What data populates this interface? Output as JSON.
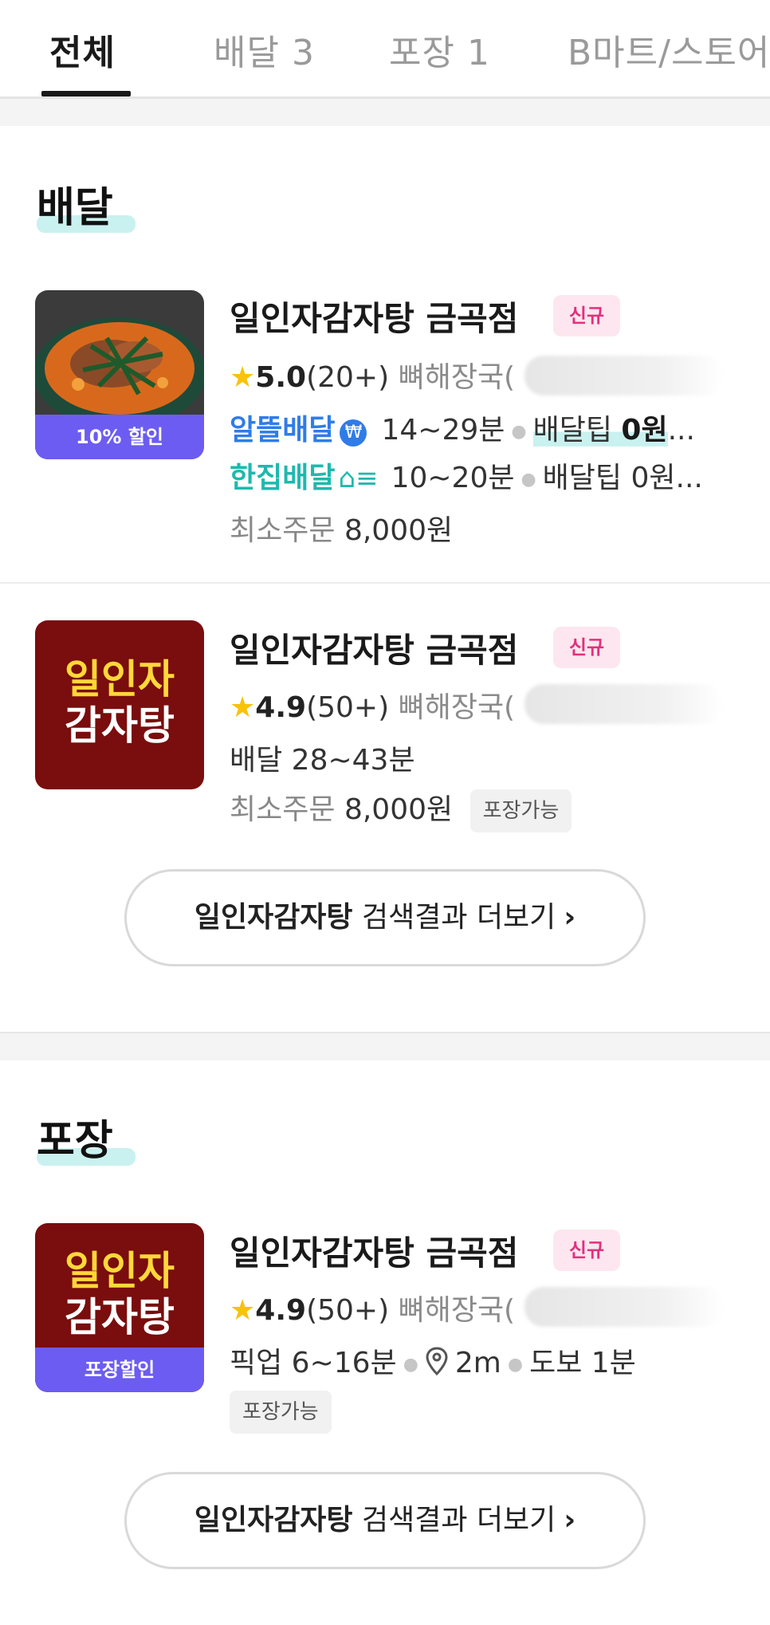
{
  "tabs": [
    {
      "label": "전체",
      "active": true
    },
    {
      "label": "배달 3",
      "active": false
    },
    {
      "label": "포장 1",
      "active": false
    },
    {
      "label": "B마트/스토어",
      "active": false
    }
  ],
  "sections": {
    "delivery": {
      "title": "배달",
      "stores": [
        {
          "name": "일인자감자탕 금곡점",
          "new_badge": "신규",
          "rating": "5.0",
          "review_count": "(20+)",
          "menu": "뼈해장국(",
          "thumb_badge": "10% 할인",
          "options": [
            {
              "brand": "알뜰배달",
              "time": "14~29분",
              "tip_label": "배달팁",
              "tip_value": "0원",
              "tip_suffix": "..."
            },
            {
              "brand": "한집배달",
              "time": "10~20분",
              "tip_label": "배달팁",
              "tip_value": "0원",
              "tip_suffix": "..."
            }
          ],
          "min_order_label": "최소주문",
          "min_order_value": "8,000원"
        },
        {
          "name": "일인자감자탕 금곡점",
          "new_badge": "신규",
          "rating": "4.9",
          "review_count": "(50+)",
          "menu": "뼈해장국(",
          "logo_line1": "일인자",
          "logo_line2": "감자탕",
          "delivery_time": "배달 28~43분",
          "min_order_label": "최소주문",
          "min_order_value": "8,000원",
          "tag": "포장가능"
        }
      ],
      "more_keyword": "일인자감자탕",
      "more_label": "검색결과 더보기"
    },
    "takeout": {
      "title": "포장",
      "store": {
        "name": "일인자감자탕 금곡점",
        "new_badge": "신규",
        "rating": "4.9",
        "review_count": "(50+)",
        "menu": "뼈해장국(",
        "logo_line1": "일인자",
        "logo_line2": "감자탕",
        "thumb_badge": "포장할인",
        "pickup": "픽업 6~16분",
        "distance": "2m",
        "walk": "도보 1분",
        "tag": "포장가능"
      },
      "more_keyword": "일인자감자탕",
      "more_label": "검색결과 더보기"
    }
  },
  "icons": {
    "star": "star-icon",
    "won_coin": "won-coin-icon",
    "house": "house-delivery-icon",
    "pin": "location-pin-icon",
    "chevron": "chevron-right-icon"
  },
  "colors": {
    "accent_blue": "#2f7ce8",
    "accent_teal": "#1fb8ae",
    "discount_purple": "#6c5cf1",
    "new_pink": "#e0317e"
  }
}
